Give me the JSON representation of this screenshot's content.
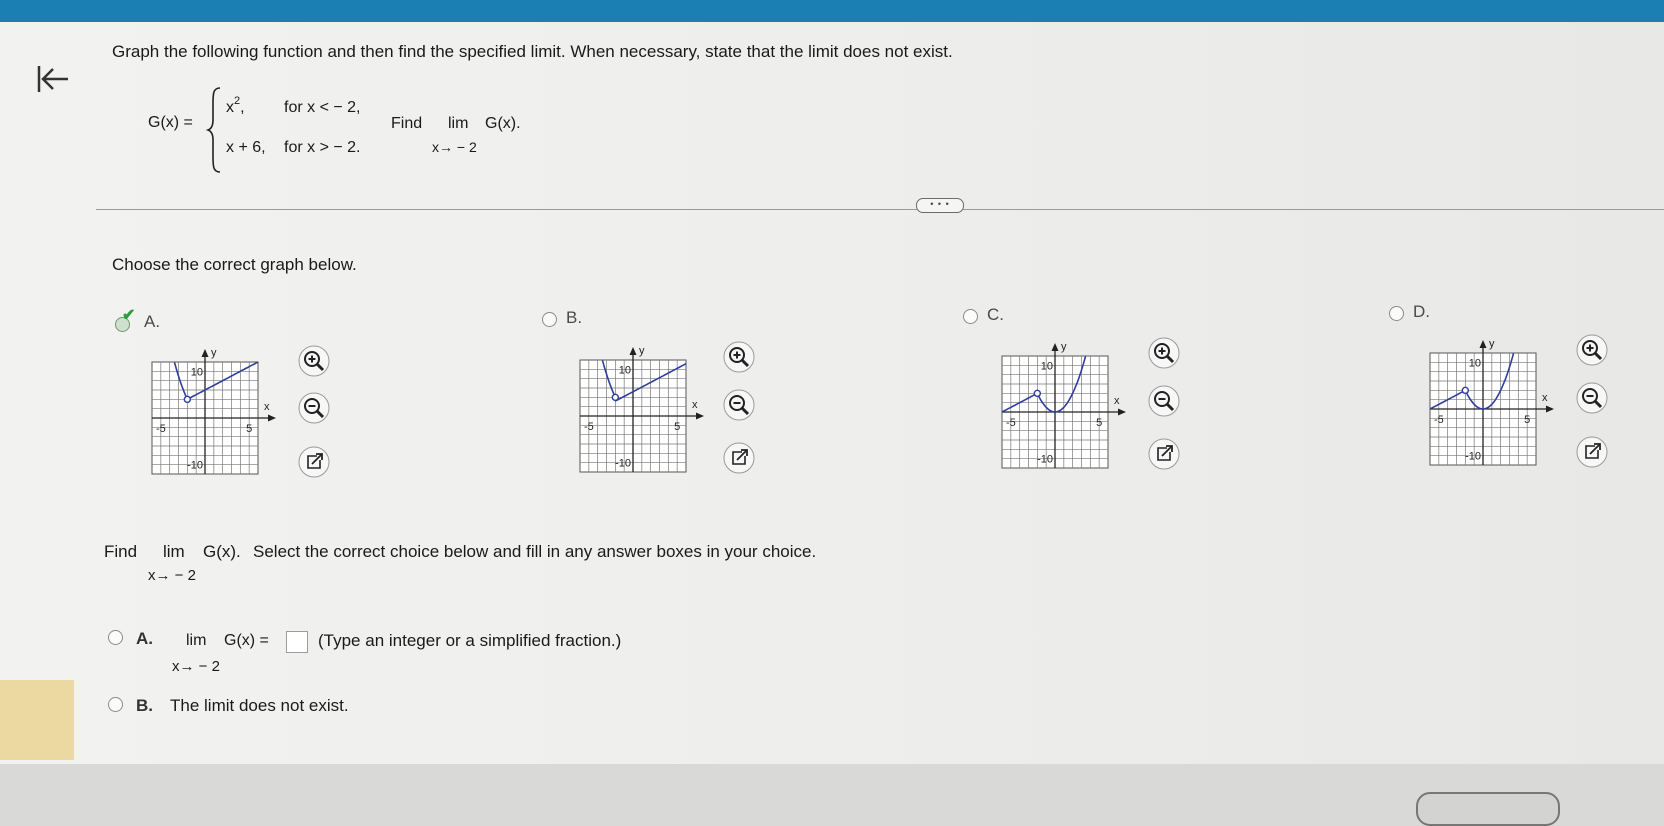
{
  "question": {
    "instruction": "Graph the following function and then find the specified limit. When necessary, state that the limit does not exist.",
    "func_name": "G(x) =",
    "piece1_expr": "x",
    "piece1_exp": "2",
    "piece1_comma": ",",
    "piece1_cond": "for x < − 2,",
    "piece2_expr": "x + 6,",
    "piece2_cond": "for x > − 2.",
    "find_word": "Find",
    "lim_word": "lim",
    "lim_func": "G(x).",
    "lim_sub": "x→ − 2"
  },
  "more_button": "• • •",
  "choose_prompt": "Choose the correct graph below.",
  "graph_options": [
    {
      "label": "A.",
      "selected": true,
      "icon": "check-icon"
    },
    {
      "label": "B.",
      "selected": false
    },
    {
      "label": "C.",
      "selected": false
    },
    {
      "label": "D.",
      "selected": false
    }
  ],
  "graph_axes": {
    "y": "y",
    "x": "x",
    "ytop": "10",
    "ybottom": "-10",
    "xleft": "-5",
    "xright": "5"
  },
  "tool_icons": [
    "zoom-in-icon",
    "zoom-out-icon",
    "external-link-icon"
  ],
  "part2": {
    "find_word": "Find",
    "lim_word": "lim",
    "lim_func": "G(x).",
    "lim_sub": "x→ − 2",
    "instruction": "Select the correct choice below and fill in any answer boxes in your choice."
  },
  "answer_a": {
    "label": "A.",
    "lim_word": "lim",
    "func_eq": "G(x) =",
    "lim_sub": "x→ − 2",
    "value": "",
    "hint": "(Type an integer or a simplified fraction.)"
  },
  "answer_b": {
    "label": "B.",
    "text": "The limit does not exist."
  },
  "colors": {
    "accent": "#1c7fb3",
    "curve": "#2f3e9e",
    "check": "#2e9a3e"
  }
}
